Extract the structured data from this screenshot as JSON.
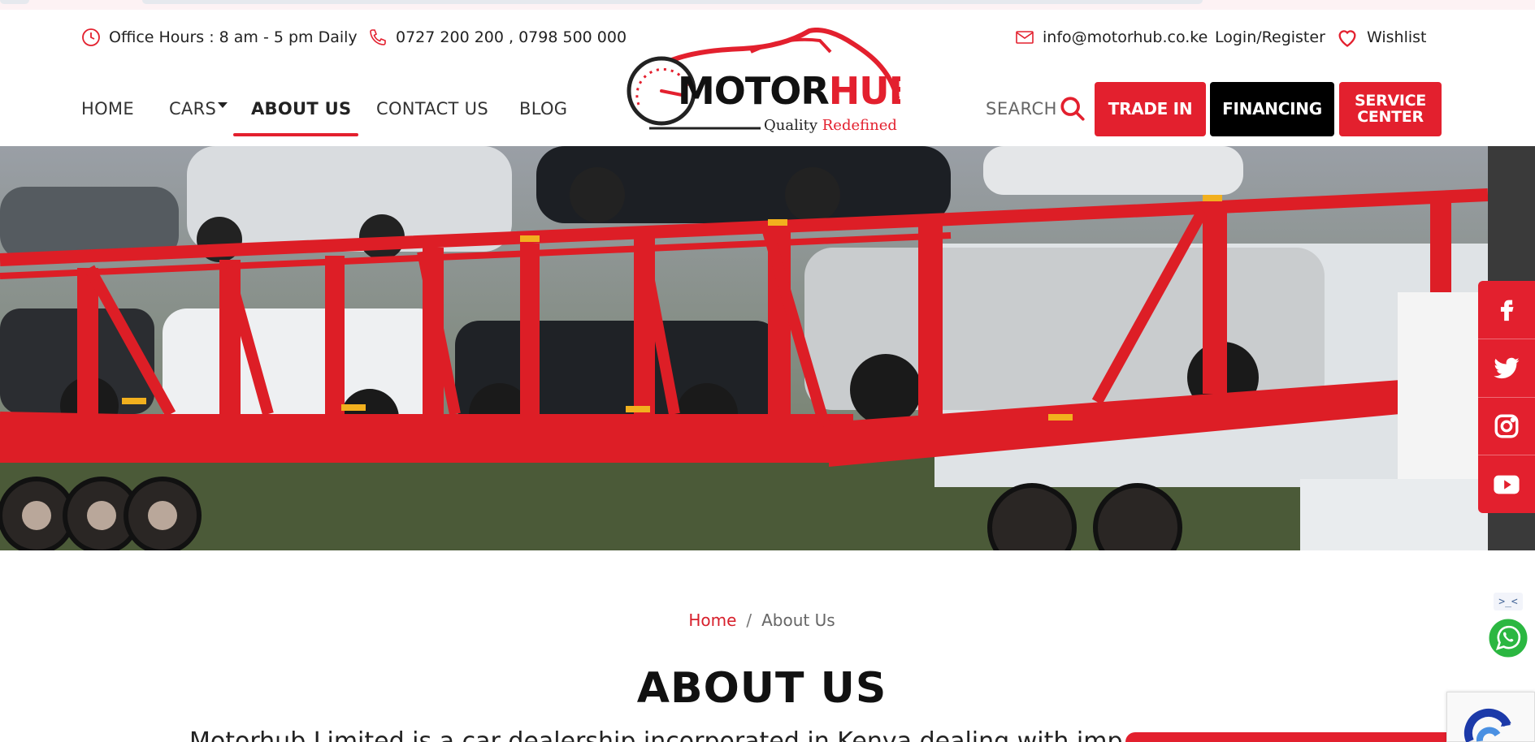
{
  "topbar": {
    "office_hours": "Office Hours : 8 am - 5 pm Daily",
    "phones": "0727 200 200 , 0798 500 000",
    "email": "info@motorhub.co.ke",
    "login": "Login/Register",
    "wishlist": "Wishlist"
  },
  "nav": {
    "items": [
      "HOME",
      "CARS",
      "ABOUT US",
      "CONTACT US",
      "BLOG"
    ],
    "active": "ABOUT US"
  },
  "logo": {
    "brand_part1": "MOTOR",
    "brand_part2": "HUB",
    "tagline_part1": "Quality",
    "tagline_part2": "Redefined"
  },
  "search": {
    "label": "SEARCH"
  },
  "buttons": {
    "trade_in": "TRADE IN",
    "financing": "FINANCING",
    "service_line1": "SERVICE",
    "service_line2": "CENTER"
  },
  "social": [
    "facebook-icon",
    "twitter-icon",
    "instagram-icon",
    "youtube-icon"
  ],
  "breadcrumb": {
    "home": "Home",
    "separator": "/",
    "current": "About Us"
  },
  "page": {
    "title": "ABOUT US",
    "intro": "Motorhub Limited is a car dealership incorporated in Kenya dealing with importation a"
  },
  "colors": {
    "brand_red": "#e3202e",
    "black": "#000000",
    "text": "#222222"
  }
}
